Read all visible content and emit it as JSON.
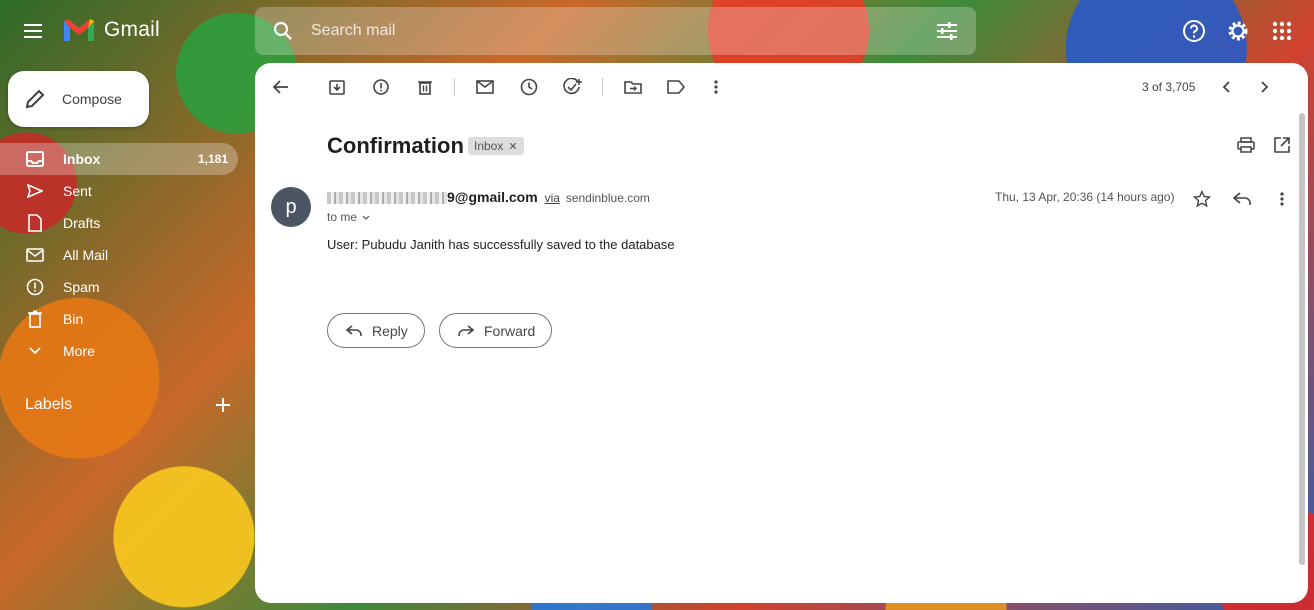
{
  "app": {
    "name": "Gmail"
  },
  "search": {
    "placeholder": "Search mail"
  },
  "compose": {
    "label": "Compose"
  },
  "nav": [
    {
      "label": "Inbox",
      "count": "1,181",
      "icon": "inbox-icon",
      "active": true
    },
    {
      "label": "Sent",
      "count": "",
      "icon": "send-icon"
    },
    {
      "label": "Drafts",
      "count": "",
      "icon": "draft-icon"
    },
    {
      "label": "All Mail",
      "count": "",
      "icon": "all-mail-icon"
    },
    {
      "label": "Spam",
      "count": "",
      "icon": "spam-icon"
    },
    {
      "label": "Bin",
      "count": "",
      "icon": "bin-icon"
    },
    {
      "label": "More",
      "count": "",
      "icon": "chevron-down-icon"
    }
  ],
  "labels": {
    "title": "Labels"
  },
  "toolbar": {
    "pager": "3 of 3,705"
  },
  "email": {
    "subject": "Confirmation",
    "badge": "Inbox",
    "avatar_letter": "p",
    "sender_visible": "9@gmail.com",
    "via": "via",
    "via_domain": "sendinblue.com",
    "to": "to me",
    "date": "Thu, 13 Apr, 20:36 (14 hours ago)",
    "body": "User: Pubudu Janith has successfully saved to the database"
  },
  "actions": {
    "reply": "Reply",
    "forward": "Forward"
  },
  "colors": {
    "accent": "#ffffff",
    "avatar": "#4b5563"
  }
}
